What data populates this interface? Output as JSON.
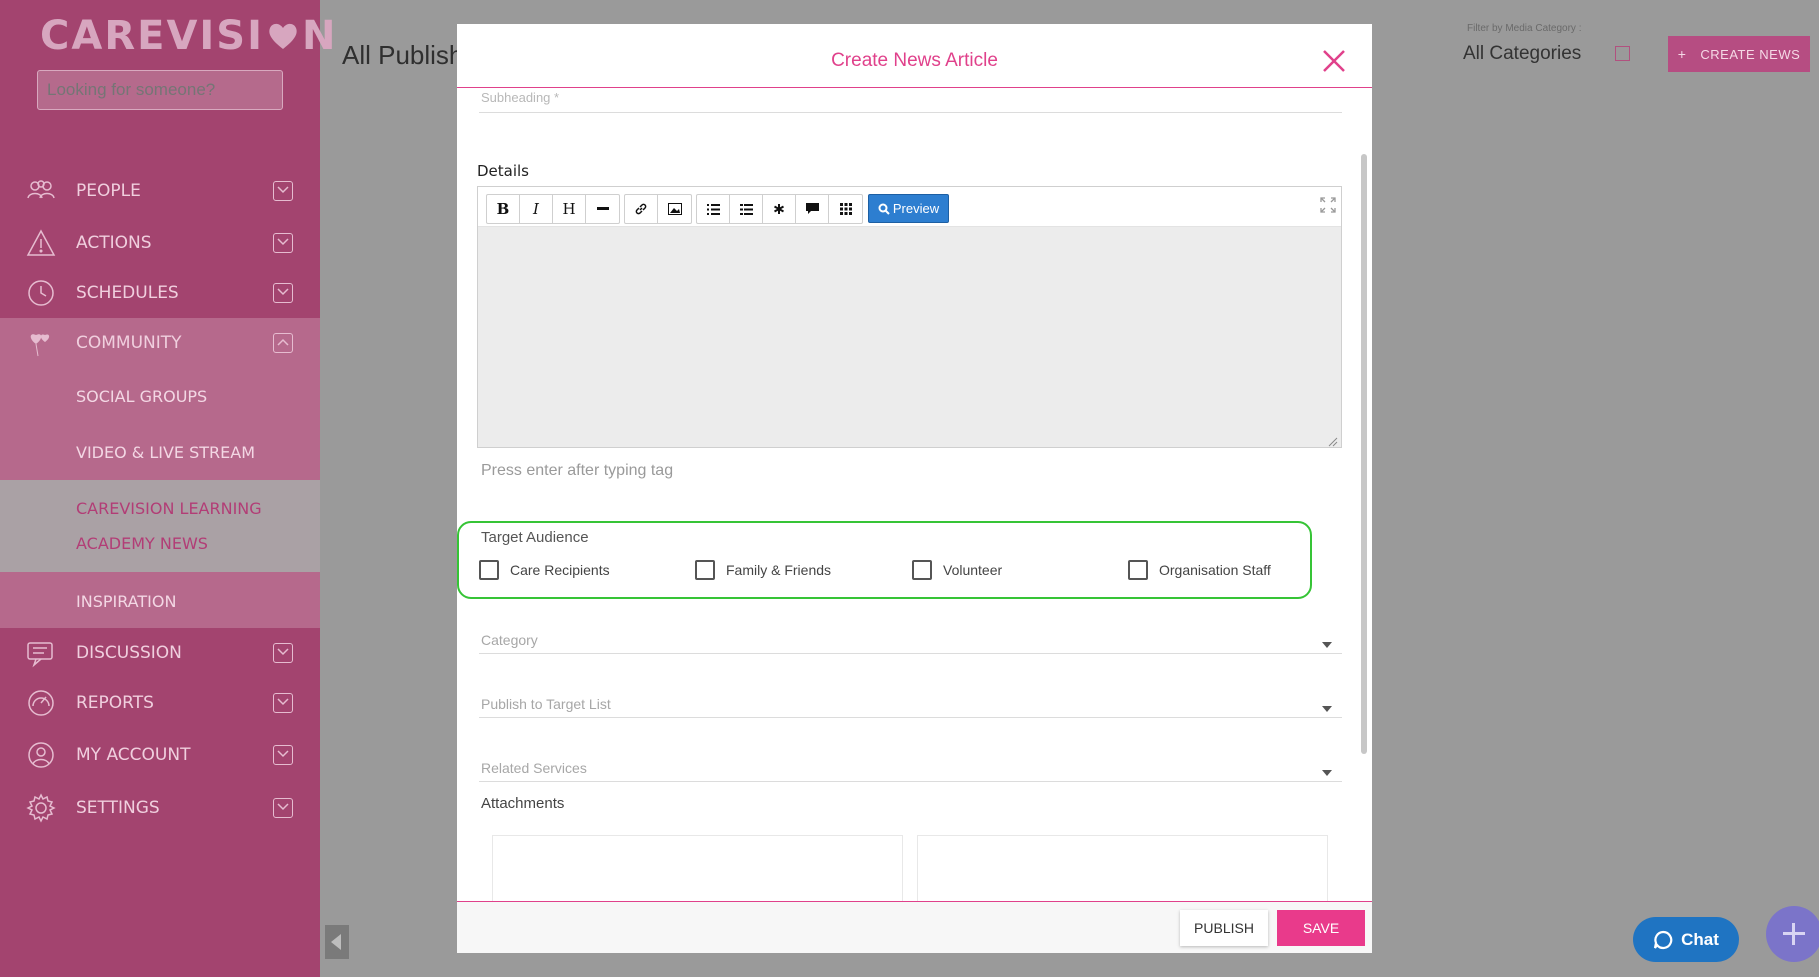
{
  "sidebar": {
    "logo": {
      "left": "CAREVISI",
      "right": "N"
    },
    "search": {
      "placeholder": "Looking for someone?"
    },
    "items": [
      {
        "label": "PEOPLE",
        "icon": "people-icon"
      },
      {
        "label": "ACTIONS",
        "icon": "warning-icon"
      },
      {
        "label": "SCHEDULES",
        "icon": "clock-icon"
      },
      {
        "label": "COMMUNITY",
        "icon": "heart-balloon-icon"
      },
      {
        "label": "DISCUSSION",
        "icon": "chat-bubbles-icon"
      },
      {
        "label": "REPORTS",
        "icon": "gauge-icon"
      },
      {
        "label": "MY ACCOUNT",
        "icon": "user-icon"
      },
      {
        "label": "SETTINGS",
        "icon": "gear-icon"
      }
    ],
    "community_sub": [
      {
        "label": "SOCIAL GROUPS"
      },
      {
        "label": "VIDEO & LIVE STREAM"
      },
      {
        "label": "CAREVISION LEARNING",
        "label2": "ACADEMY NEWS"
      },
      {
        "label": "INSPIRATION"
      }
    ]
  },
  "header": {
    "page_title": "All Publish",
    "filter_label": "Filter by Media Category :",
    "filter_value": "All Categories",
    "create_news": "CREATE NEWS",
    "create_news_plus": "+"
  },
  "modal": {
    "title": "Create News Article",
    "subheading_label": "Subheading *",
    "details_label": "Details",
    "toolbar": {
      "bold": "B",
      "italic": "I",
      "heading": "H",
      "preview": "Preview"
    },
    "tag_placeholder": "Press enter after typing tag",
    "target_audience": {
      "label": "Target Audience",
      "options": [
        "Care Recipients",
        "Family & Friends",
        "Volunteer",
        "Organisation Staff"
      ]
    },
    "category_label": "Category",
    "target_list_label": "Publish to Target List",
    "related_services_label": "Related Services",
    "attachments_label": "Attachments",
    "publish": "PUBLISH",
    "save": "SAVE"
  },
  "chat": {
    "label": "Chat"
  },
  "colors": {
    "brand": "#a3446f",
    "accent": "#e0418b",
    "highlight": "#36c436",
    "chat": "#1f74c2"
  }
}
